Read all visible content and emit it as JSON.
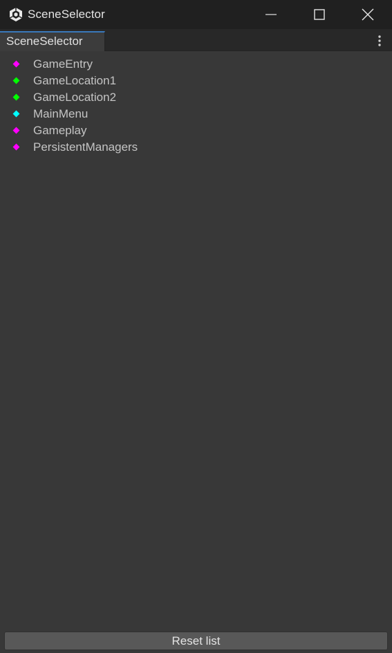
{
  "window": {
    "title": "SceneSelector"
  },
  "tab": {
    "label": "SceneSelector"
  },
  "scenes": [
    {
      "label": "GameEntry",
      "color": "#ff00ff"
    },
    {
      "label": "GameLocation1",
      "color": "#00ff00"
    },
    {
      "label": "GameLocation2",
      "color": "#00ff00"
    },
    {
      "label": "MainMenu",
      "color": "#00ffff"
    },
    {
      "label": "Gameplay",
      "color": "#ff00ff"
    },
    {
      "label": "PersistentManagers",
      "color": "#ff00ff"
    }
  ],
  "footer": {
    "reset_label": "Reset list"
  },
  "icons": {
    "app": "unity-logo-icon",
    "minimize": "minimize-icon",
    "maximize": "maximize-icon",
    "close": "close-icon",
    "menu": "kebab-menu-icon"
  }
}
